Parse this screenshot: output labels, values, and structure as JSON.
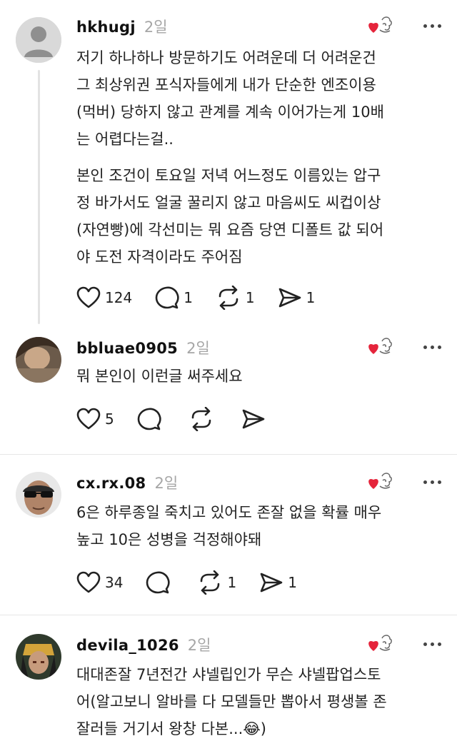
{
  "posts": [
    {
      "username": "hkhugj",
      "time": "2일",
      "paragraphs": [
        [
          "저기 하나하나 방문하기도 어려운데 더 어려운건",
          "그 최상위권 포식자들에게 내가 단순한 엔조이용",
          "(먹버) 당하지 않고 관계를 계속 이어가는게 10배",
          "는 어렵다는걸.."
        ],
        [
          "본인 조건이 토요일 저녁 어느정도 이름있는 압구",
          "정 바가서도 얼굴 꿀리지 않고 마음씨도 씨컵이상",
          "(자연빵)에 각선미는 뭐 요즘 당연 디폴트 값 되어",
          "야 도전 자격이라도 주어짐"
        ]
      ],
      "likes": "124",
      "replies": "1",
      "reposts": "1",
      "shares": "1"
    },
    {
      "username": "bbluae0905",
      "time": "2일",
      "paragraphs": [
        [
          "뭐 본인이 이런글 써주세요"
        ]
      ],
      "likes": "5",
      "replies": "",
      "reposts": "",
      "shares": ""
    },
    {
      "username": "cx.rx.08",
      "time": "2일",
      "paragraphs": [
        [
          "6은 하루종일 죽치고 있어도 존잘 없을 확률 매우",
          "높고 10은 성병을 걱정해야돼"
        ]
      ],
      "likes": "34",
      "replies": "",
      "reposts": "1",
      "shares": "1"
    },
    {
      "username": "devila_1026",
      "time": "2일",
      "paragraphs": [
        [
          "대대존잘 7년전간 샤넬립인가 무슨 샤넬팝업스토",
          "어(알고보니 알바를 다 모델들만 뽑아서 평생볼 존",
          "잘러들 거기서 왕창 다본...😂)"
        ]
      ],
      "likes": "",
      "replies": "",
      "reposts": "",
      "shares": ""
    }
  ],
  "icons": {
    "like": "heart-outline-icon",
    "reply": "speech-bubble-icon",
    "repost": "repost-arrows-icon",
    "share": "paper-plane-icon",
    "more": "more-dots-icon",
    "reaction": "heart-doodle-reaction-icon"
  },
  "colors": {
    "reaction_heart": "#e5243b",
    "muted": "#a6a6a6"
  }
}
